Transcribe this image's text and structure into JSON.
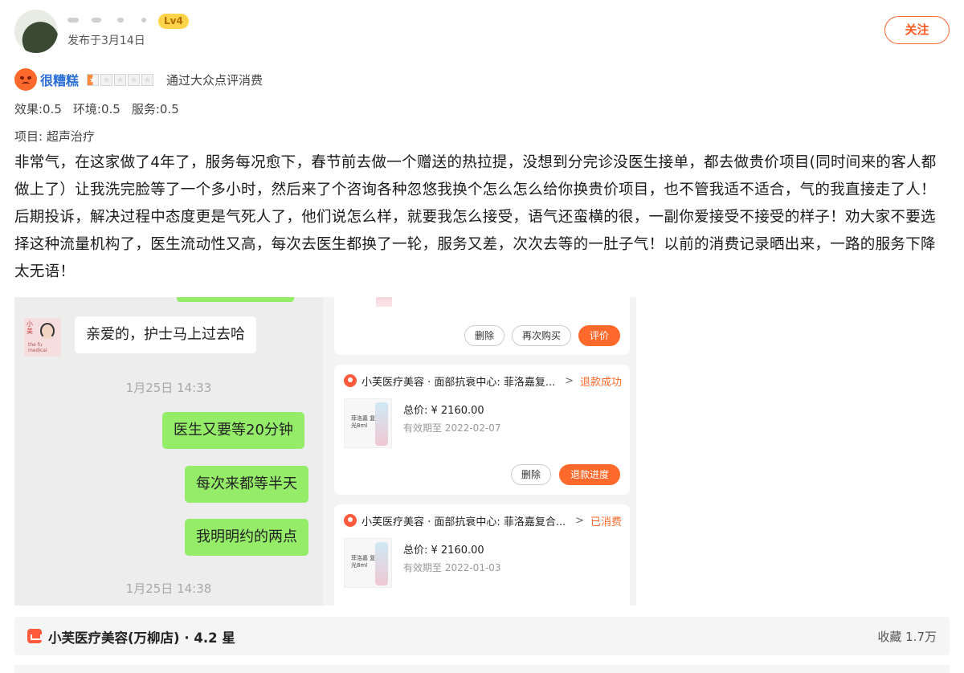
{
  "header": {
    "level_badge": "Lv4",
    "publish_date": "发布于3月14日",
    "follow_label": "关注"
  },
  "rating": {
    "label": "很糟糕",
    "stars": 0.5,
    "consume_note": "通过大众点评消费"
  },
  "scores": [
    "效果:0.5",
    "环境:0.5",
    "服务:0.5"
  ],
  "project": "项目:  超声治疗",
  "review_text": "非常气，在这家做了4年了，服务每况愈下，春节前去做一个赠送的热拉提，没想到分完诊没医生接单，都去做贵价项目(同时间来的客人都做上了）让我洗完脸等了一个多小时，然后来了个咨询各种忽悠我换个怎么怎么给你换贵价项目，也不管我适不适合，气的我直接走了人！后期投诉，解决过程中态度更是气死人了，他们说怎么样，就要我怎么接受，语气还蛮横的很，一副你爱接受不接受的样子！劝大家不要选择这种流量机构了，医生流动性又高，每次去医生都换了一轮，服务又差，次次去等的一肚子气！以前的消费记录晒出来，一路的服务下降太无语！",
  "chat": {
    "bot_label": "小美",
    "bot_tag": "the fu medical",
    "message_left": "亲爱的，护士马上过去哈",
    "time1": "1月25日 14:33",
    "message_right_1": "医生又要等20分钟",
    "message_right_2": "每次来都等半天",
    "message_right_3": "我明明约的两点",
    "time2": "1月25日 14:38"
  },
  "orders": {
    "card1_buttons": [
      "删除",
      "再次购买",
      "评价"
    ],
    "card2": {
      "shop": "小芙医疗美容 · 面部抗衰中心:  菲洛嘉复...",
      "status": "退款成功",
      "total": "总价:  ¥ 2160.00",
      "valid": "有效期至 2022-02-07",
      "buttons": [
        "删除",
        "退款进度"
      ]
    },
    "card3": {
      "shop": "小芙医疗美容 · 面部抗衰中心:  菲洛嘉复合...",
      "status": "已消费",
      "total": "总价:  ¥ 2160.00",
      "valid": "有效期至 2022-01-03"
    },
    "product_text": "菲洛嘉 复合水光8ml"
  },
  "shop_bar": {
    "name": "小芙医疗美容(万柳店) · 4.2 星",
    "favorites": "收藏 1.7万"
  },
  "colors": {
    "accent": "#ff6a2c",
    "link_blue": "#2b6fd6",
    "chat_green": "#95ec69"
  }
}
